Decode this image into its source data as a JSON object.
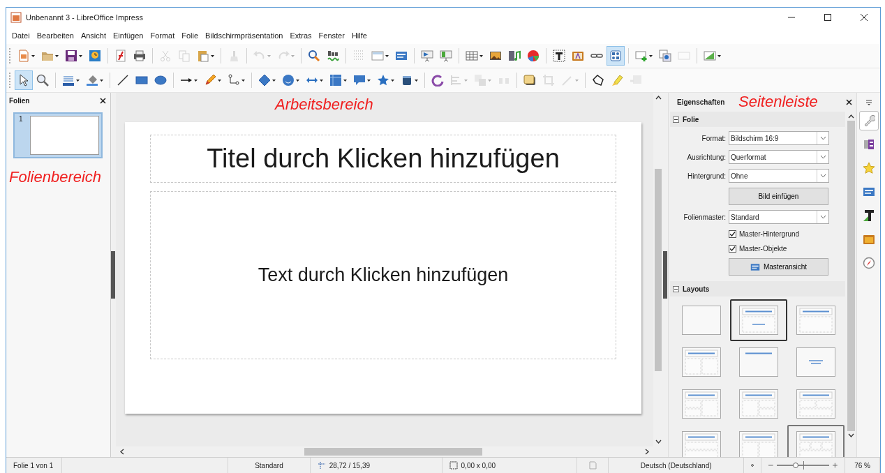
{
  "window": {
    "title": "Unbenannt 3 - LibreOffice Impress"
  },
  "menu": [
    "Datei",
    "Bearbeiten",
    "Ansicht",
    "Einfügen",
    "Format",
    "Folie",
    "Bildschirmpräsentation",
    "Extras",
    "Fenster",
    "Hilfe"
  ],
  "toolbars": [
    {
      "buttons": [
        {
          "active": false,
          "disabled": false
        },
        {
          "active": false,
          "disabled": false
        },
        {
          "active": false,
          "disabled": false
        },
        {
          "active": false,
          "disabled": false
        },
        {
          "active": false,
          "disabled": false
        },
        {
          "active": false,
          "disabled": false
        },
        {
          "active": false,
          "disabled": true
        },
        {
          "active": false,
          "disabled": true
        },
        {
          "active": false,
          "disabled": false
        },
        {
          "active": false,
          "disabled": true
        },
        {
          "active": false,
          "disabled": true
        },
        {
          "active": false,
          "disabled": true
        },
        {
          "active": false,
          "disabled": false
        },
        {
          "active": false,
          "disabled": false
        },
        {
          "active": false,
          "disabled": false
        },
        {
          "active": false,
          "disabled": false
        },
        {
          "active": false,
          "disabled": false
        },
        {
          "active": false,
          "disabled": false
        },
        {
          "active": false,
          "disabled": false
        },
        {
          "active": false,
          "disabled": false
        },
        {
          "active": false,
          "disabled": false
        },
        {
          "active": false,
          "disabled": false
        },
        {
          "active": false,
          "disabled": false
        },
        {
          "active": false,
          "disabled": false
        },
        {
          "active": false,
          "disabled": false
        },
        {
          "active": false,
          "disabled": false
        },
        {
          "active": true,
          "disabled": false
        },
        {
          "active": false,
          "disabled": false
        },
        {
          "active": false,
          "disabled": false
        },
        {
          "active": false,
          "disabled": true
        },
        {
          "active": false,
          "disabled": false
        }
      ]
    },
    {
      "buttons": [
        {
          "active": true,
          "disabled": false
        },
        {
          "active": false,
          "disabled": false
        },
        {
          "active": false,
          "disabled": false
        },
        {
          "active": false,
          "disabled": false
        },
        {
          "active": false,
          "disabled": false
        },
        {
          "active": false,
          "disabled": false
        },
        {
          "active": false,
          "disabled": false
        },
        {
          "active": false,
          "disabled": false
        },
        {
          "active": false,
          "disabled": false
        },
        {
          "active": false,
          "disabled": false
        },
        {
          "active": false,
          "disabled": false
        },
        {
          "active": false,
          "disabled": false
        },
        {
          "active": false,
          "disabled": false
        },
        {
          "active": false,
          "disabled": false
        },
        {
          "active": false,
          "disabled": false
        },
        {
          "active": false,
          "disabled": false
        },
        {
          "active": false,
          "disabled": false
        },
        {
          "active": false,
          "disabled": false
        },
        {
          "active": false,
          "disabled": true
        },
        {
          "active": false,
          "disabled": true
        },
        {
          "active": false,
          "disabled": true
        },
        {
          "active": false,
          "disabled": false
        },
        {
          "active": false,
          "disabled": true
        },
        {
          "active": false,
          "disabled": true
        },
        {
          "active": false,
          "disabled": false
        },
        {
          "active": false,
          "disabled": false
        },
        {
          "active": false,
          "disabled": true
        }
      ]
    }
  ],
  "slides_pane": {
    "title": "Folien",
    "annotation": "Folienbereich",
    "slides": [
      {
        "number": "1",
        "selected": true
      }
    ]
  },
  "workspace": {
    "annotation": "Arbeitsbereich",
    "slide": {
      "title": "Titel durch Klicken hinzufügen",
      "content": "Text durch Klicken hinzufügen"
    }
  },
  "sidebar": {
    "title": "Eigenschaften",
    "annotation": "Seitenleiste",
    "slide_section": {
      "heading": "Folie",
      "expanded": true,
      "fields": [
        {
          "label": "Format:",
          "value": "Bildschirm 16:9"
        },
        {
          "label": "Ausrichtung:",
          "value": "Querformat"
        },
        {
          "label": "Hintergrund:",
          "value": "Ohne"
        }
      ],
      "insert_image_button": "Bild einfügen",
      "master": {
        "label": "Folienmaster:",
        "value": "Standard"
      },
      "checkboxes": [
        {
          "label": "Master-Hintergrund",
          "checked": true
        },
        {
          "label": "Master-Objekte",
          "checked": true
        }
      ],
      "master_view_button": "Masteransicht"
    },
    "layouts_section": {
      "heading": "Layouts",
      "expanded": true,
      "items": [
        {
          "kind": "blank",
          "selected": false,
          "hovered": false
        },
        {
          "kind": "title-centered",
          "selected": true,
          "hovered": false
        },
        {
          "kind": "title-content",
          "selected": false,
          "hovered": false
        },
        {
          "kind": "title-two-columns",
          "selected": false,
          "hovered": false
        },
        {
          "kind": "title-only",
          "selected": false,
          "hovered": false
        },
        {
          "kind": "centered-text",
          "selected": false,
          "hovered": false
        },
        {
          "kind": "two-left-one-right",
          "selected": false,
          "hovered": false
        },
        {
          "kind": "one-left-two-right",
          "selected": false,
          "hovered": false
        },
        {
          "kind": "two-top-one-bottom",
          "selected": false,
          "hovered": false
        },
        {
          "kind": "top-bottom",
          "selected": false,
          "hovered": false
        },
        {
          "kind": "title-two-columns",
          "selected": false,
          "hovered": false
        },
        {
          "kind": "three-columns",
          "selected": false,
          "hovered": true
        }
      ]
    },
    "tabs": [
      {
        "selected": true
      },
      {
        "selected": false
      },
      {
        "selected": false
      },
      {
        "selected": false
      },
      {
        "selected": false
      },
      {
        "selected": false
      },
      {
        "selected": false
      }
    ]
  },
  "status_bar": {
    "slide": "Folie 1 von 1",
    "master": "Standard",
    "position": "28,72 / 15,39",
    "size": "0,00 x 0,00",
    "language": "Deutsch (Deutschland)",
    "zoom": {
      "level": 0.36,
      "reading": "76 %"
    }
  }
}
